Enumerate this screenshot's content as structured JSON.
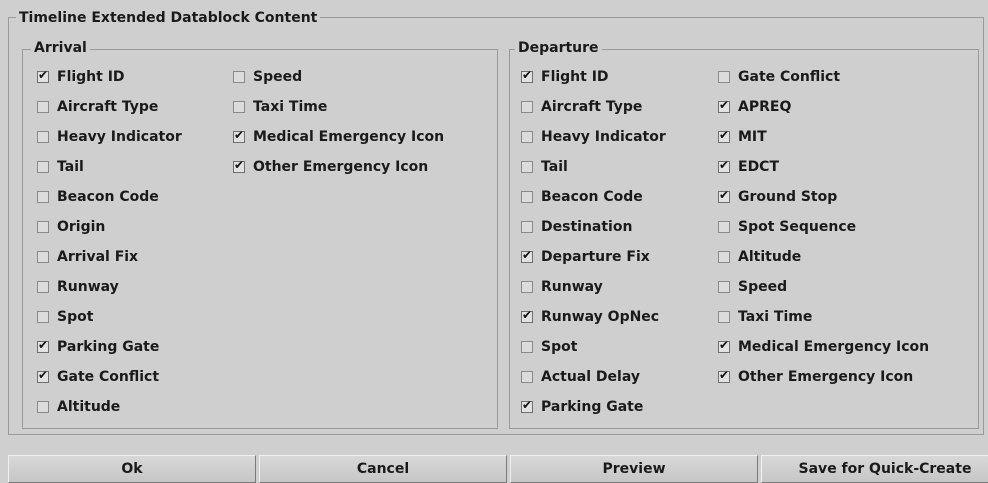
{
  "dialog": {
    "title": "Timeline Extended Datablock Content"
  },
  "arrival": {
    "title": "Arrival",
    "col1": [
      {
        "label": "Flight ID",
        "checked": true
      },
      {
        "label": "Aircraft Type",
        "checked": false
      },
      {
        "label": "Heavy Indicator",
        "checked": false
      },
      {
        "label": "Tail",
        "checked": false
      },
      {
        "label": "Beacon Code",
        "checked": false
      },
      {
        "label": "Origin",
        "checked": false
      },
      {
        "label": "Arrival Fix",
        "checked": false
      },
      {
        "label": "Runway",
        "checked": false
      },
      {
        "label": "Spot",
        "checked": false
      },
      {
        "label": "Parking Gate",
        "checked": true
      },
      {
        "label": "Gate Conflict",
        "checked": true
      },
      {
        "label": "Altitude",
        "checked": false
      }
    ],
    "col2": [
      {
        "label": "Speed",
        "checked": false
      },
      {
        "label": "Taxi Time",
        "checked": false
      },
      {
        "label": "Medical Emergency Icon",
        "checked": true
      },
      {
        "label": "Other Emergency Icon",
        "checked": true
      }
    ]
  },
  "departure": {
    "title": "Departure",
    "col1": [
      {
        "label": "Flight ID",
        "checked": true
      },
      {
        "label": "Aircraft Type",
        "checked": false
      },
      {
        "label": "Heavy Indicator",
        "checked": false
      },
      {
        "label": "Tail",
        "checked": false
      },
      {
        "label": "Beacon Code",
        "checked": false
      },
      {
        "label": "Destination",
        "checked": false
      },
      {
        "label": "Departure Fix",
        "checked": true
      },
      {
        "label": "Runway",
        "checked": false
      },
      {
        "label": "Runway OpNec",
        "checked": true
      },
      {
        "label": "Spot",
        "checked": false
      },
      {
        "label": "Actual Delay",
        "checked": false
      },
      {
        "label": "Parking Gate",
        "checked": true
      }
    ],
    "col2": [
      {
        "label": "Gate Conflict",
        "checked": false
      },
      {
        "label": "APREQ",
        "checked": true
      },
      {
        "label": "MIT",
        "checked": true
      },
      {
        "label": "EDCT",
        "checked": true
      },
      {
        "label": "Ground Stop",
        "checked": true
      },
      {
        "label": "Spot Sequence",
        "checked": false
      },
      {
        "label": "Altitude",
        "checked": false
      },
      {
        "label": "Speed",
        "checked": false
      },
      {
        "label": "Taxi Time",
        "checked": false
      },
      {
        "label": "Medical Emergency Icon",
        "checked": true
      },
      {
        "label": "Other Emergency Icon",
        "checked": true
      }
    ]
  },
  "buttons": {
    "ok": "Ok",
    "cancel": "Cancel",
    "preview": "Preview",
    "save_quick_create": "Save for Quick-Create"
  }
}
